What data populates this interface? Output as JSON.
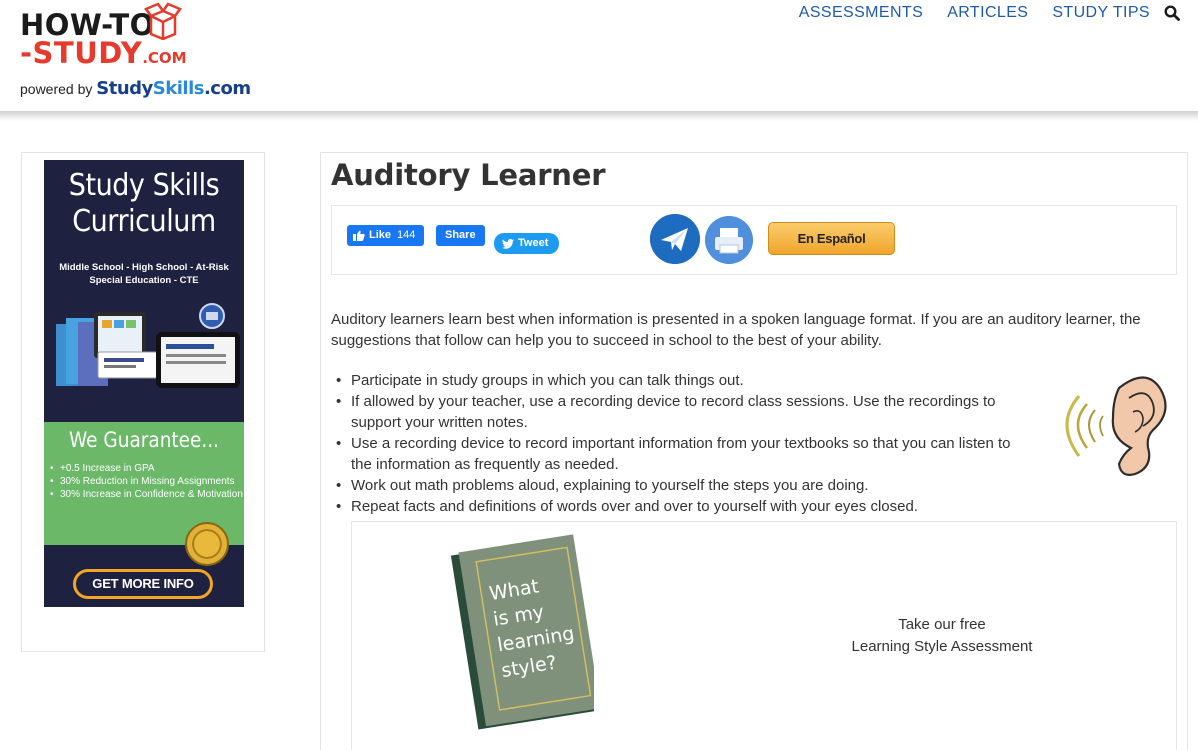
{
  "logo": {
    "line1_a": "HOW-TO",
    "line2_a": "-STUDY",
    "line2_b": ".COM",
    "powered_by": "powered by",
    "studyskills_a": "Study",
    "studyskills_b": "Skills",
    "studyskills_c": ".com"
  },
  "nav": {
    "items": [
      "ASSESSMENTS",
      "ARTICLES",
      "STUDY TIPS"
    ],
    "search_icon": "search-icon"
  },
  "ad": {
    "title_line1": "Study Skills",
    "title_line2": "Curriculum",
    "sub_line1": "Middle School - High School - At-Risk",
    "sub_line2": "Special Education - CTE",
    "guarantee": "We Guarantee...",
    "bullets": [
      "+0.5 Increase in GPA",
      "30% Reduction in Missing Assignments",
      "30% Increase in Confidence & Motivation"
    ],
    "button": "GET MORE INFO",
    "colors": {
      "background": "#1f2140",
      "green": "#6bb868",
      "button_border": "#f2a626"
    }
  },
  "main": {
    "title": "Auditory Learner",
    "share": {
      "like_label": "Like",
      "like_count": "144",
      "share_label": "Share",
      "tweet_label": "Tweet",
      "espanol_label": "En Español"
    },
    "intro": "Auditory learners learn best when information is presented in a spoken language format. If you are an auditory learner, the suggestions that follow can help you to succeed in school to the best of your ability.",
    "bullets": [
      "Participate in study groups in which you can talk things out.",
      "If allowed by your teacher, use a recording device to record class sessions. Use the recordings to support your written notes.",
      "Use a recording device to record important information from your textbooks so that you can listen to the information as frequently as needed.",
      "Work out math problems aloud, explaining to yourself the steps you are doing.",
      "Repeat facts and definitions of words over and over to yourself with your eyes closed."
    ],
    "promo": {
      "book_text": [
        "What",
        "is my",
        "learning",
        "style?"
      ],
      "line1": "Take our free",
      "line2": "Learning Style Assessment"
    }
  },
  "colors": {
    "nav_link": "#1e5ba8",
    "logo_red": "#e53a2c",
    "facebook": "#1877f2",
    "twitter": "#1d9bf0",
    "espanol": "#f0a52b"
  }
}
